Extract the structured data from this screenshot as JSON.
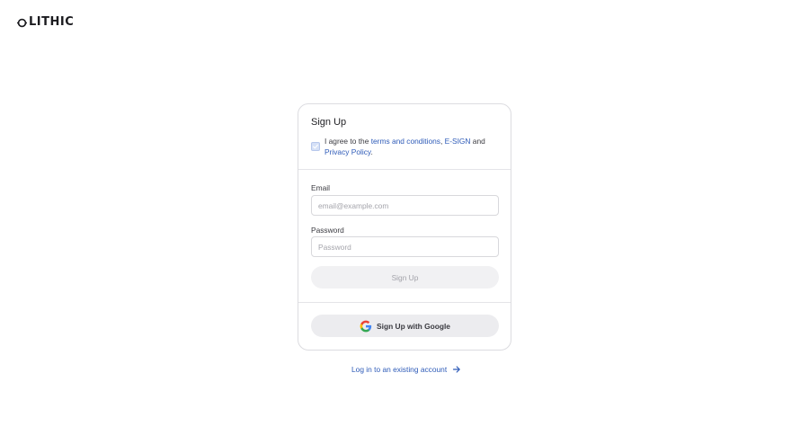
{
  "brand": {
    "name": "LITHIC",
    "logo_icon": "lithic-ring-logo"
  },
  "signup_card": {
    "title": "Sign Up",
    "agreement": {
      "checked": true,
      "prefix": "I agree to the ",
      "terms_link": "terms and conditions",
      "sep1": ", ",
      "esign_link": "E-SIGN",
      "sep2": " and ",
      "privacy_link": "Privacy Policy",
      "suffix": "."
    },
    "email": {
      "label": "Email",
      "placeholder": "email@example.com",
      "value": ""
    },
    "password": {
      "label": "Password",
      "placeholder": "Password",
      "value": ""
    },
    "submit_label": "Sign Up",
    "google_label": "Sign Up with Google",
    "google_icon": "google-g-icon"
  },
  "login_link": {
    "label": "Log in to an existing account",
    "icon": "arrow-right-icon"
  },
  "colors": {
    "link": "#2e5bb8",
    "border": "#dcdce0",
    "button_bg": "#f1f1f3"
  }
}
